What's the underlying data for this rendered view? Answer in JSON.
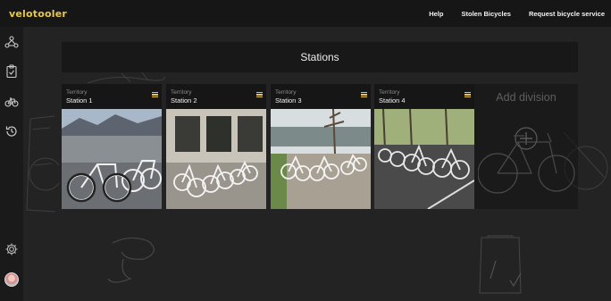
{
  "app": {
    "logo": "velotooler"
  },
  "nav": [
    {
      "label": "Help"
    },
    {
      "label": "Stolen Bicycles"
    },
    {
      "label": "Request bicycle service"
    }
  ],
  "sidebar": {
    "items": [
      {
        "icon": "network-icon"
      },
      {
        "icon": "clipboard-check-icon"
      },
      {
        "icon": "bicycle-icon"
      },
      {
        "icon": "history-icon"
      },
      {
        "icon": "gear-icon"
      },
      {
        "icon": "avatar"
      }
    ]
  },
  "page": {
    "title": "Stations"
  },
  "stations": [
    {
      "territory": "Territory",
      "name": "Station 1"
    },
    {
      "territory": "Territory",
      "name": "Station 2"
    },
    {
      "territory": "Territory",
      "name": "Station 3"
    },
    {
      "territory": "Territory",
      "name": "Station 4"
    }
  ],
  "add_division": {
    "label": "Add division"
  },
  "colors": {
    "accent": "#e8c84a",
    "background": "#232323",
    "topbar": "#161616",
    "card": "#161616"
  }
}
